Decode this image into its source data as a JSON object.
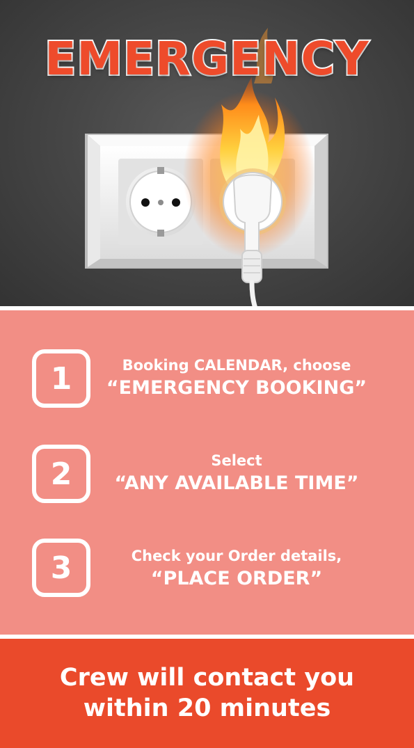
{
  "title": "EMERGENCY",
  "illustration": {
    "icon": "burning-power-outlet-icon",
    "description_visible": false
  },
  "steps": [
    {
      "number": "1",
      "line1": "Booking CALENDAR, choose",
      "line2": "“EMERGENCY BOOKING”"
    },
    {
      "number": "2",
      "line1": "Select",
      "line2": "“ANY AVAILABLE TIME”"
    },
    {
      "number": "3",
      "line1": "Check your Order details,",
      "line2": "“PLACE ORDER”"
    }
  ],
  "footer": {
    "line1": "Crew will contact you",
    "line2": "within 20 minutes"
  },
  "colors": {
    "dark_background": "#474747",
    "accent_red": "#ea4a2b",
    "steps_background": "#f28e85",
    "white": "#ffffff"
  }
}
